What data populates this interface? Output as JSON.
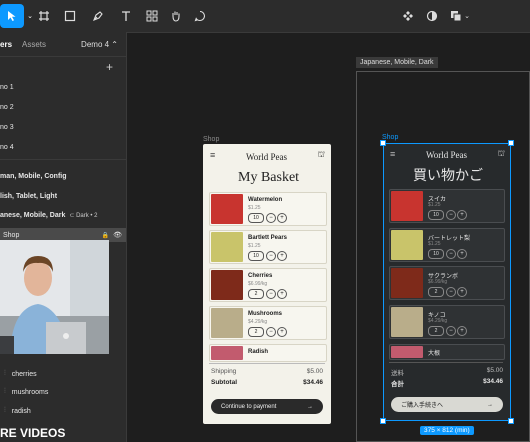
{
  "toolbar": {
    "move_icon": "cursor-arrow",
    "tools": [
      "frame-hash",
      "rectangle",
      "pen",
      "text",
      "components",
      "hand",
      "comment"
    ],
    "right_tools": [
      "component-diamond",
      "contrast",
      "boolean-square"
    ]
  },
  "layers_panel": {
    "tab_layers": "ers",
    "tab_assets": "Assets",
    "page_selector": "Demo 4",
    "add_icon": "+",
    "pages": [
      "no 1",
      "no 2",
      "no 3",
      "no 4"
    ],
    "frames": [
      "man, Mobile, Config",
      "lish, Tablet, Light",
      "anese, Mobile, Dark"
    ],
    "frame_badge": "Dark • 2",
    "selected_layer": "Shop",
    "bottom_layers": [
      "cherries",
      "mushrooms",
      "radish"
    ],
    "overlay_caption": "RE VIDEOS"
  },
  "canvas": {
    "outer_frame_label": "Japanese, Mobile, Dark",
    "light_label": "Shop",
    "dark_label": "Shop",
    "size_badge": "375 × 812 (min)"
  },
  "light_phone": {
    "brand": "World Peas",
    "title": "My Basket",
    "items": [
      {
        "name": "Watermelon",
        "price": "$1.25",
        "qty": "10",
        "color": "#c8342f"
      },
      {
        "name": "Bartlett Pears",
        "price": "$1.25",
        "qty": "10",
        "color": "#c9c46a"
      },
      {
        "name": "Cherries",
        "price": "$6.99/kg",
        "qty": "2",
        "color": "#7e2a1a"
      },
      {
        "name": "Mushrooms",
        "price": "$4.29/kg",
        "qty": "2",
        "color": "#b9ad8a"
      },
      {
        "name": "Radish",
        "price": "",
        "qty": "",
        "color": "#c25b6e"
      }
    ],
    "shipping_label": "Shipping",
    "shipping_value": "$5.00",
    "subtotal_label": "Subtotal",
    "subtotal_value": "$34.46",
    "pay_label": "Continue to payment",
    "arrow": "→"
  },
  "dark_phone": {
    "brand": "World Peas",
    "title": "買い物かご",
    "items": [
      {
        "name": "スイカ",
        "price": "$1.25",
        "qty": "10",
        "color": "#c8342f"
      },
      {
        "name": "バートレット梨",
        "price": "$1.25",
        "qty": "10",
        "color": "#c9c46a"
      },
      {
        "name": "サクランボ",
        "price": "$6.99/kg",
        "qty": "2",
        "color": "#7e2a1a"
      },
      {
        "name": "キノコ",
        "price": "$4.29/kg",
        "qty": "2",
        "color": "#b9ad8a"
      },
      {
        "name": "大根",
        "price": "",
        "qty": "",
        "color": "#c25b6e"
      }
    ],
    "shipping_label": "送料",
    "shipping_value": "$5.00",
    "subtotal_label": "合計",
    "subtotal_value": "$34.46",
    "pay_label": "ご購入手続きへ",
    "arrow": "→"
  },
  "colors": {
    "accent": "#0d99ff",
    "toolbar_bg": "#2c2c2c",
    "canvas_bg": "#1e1e1e",
    "light_phone_bg": "#f3f2ea",
    "dark_phone_bg": "#272a2c"
  }
}
